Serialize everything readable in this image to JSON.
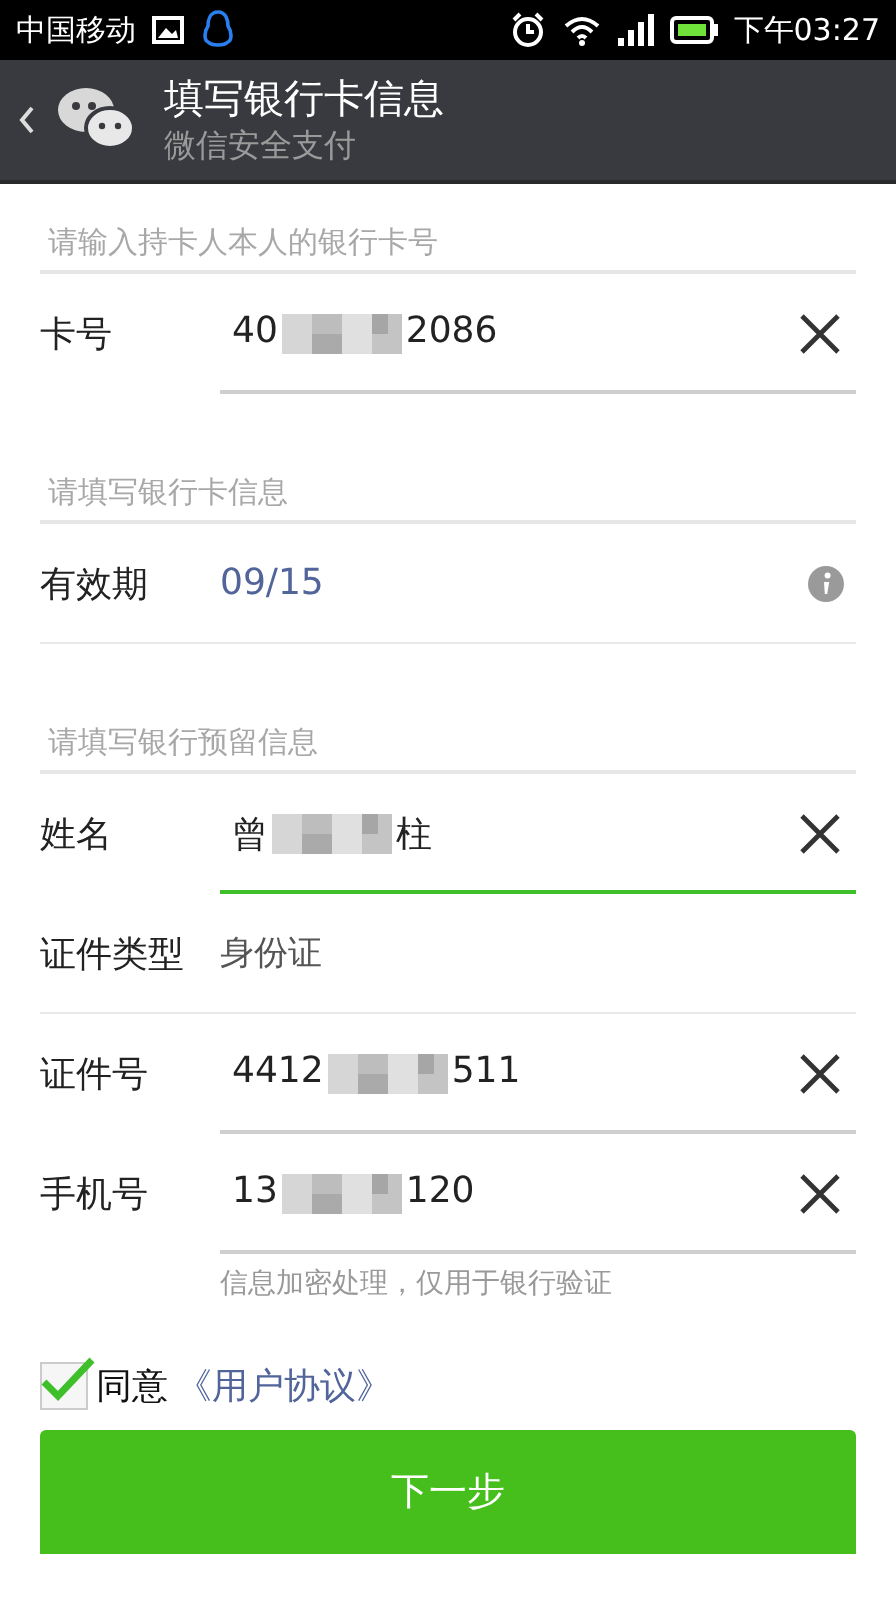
{
  "status_bar": {
    "carrier": "中国移动",
    "time": "下午03:27"
  },
  "header": {
    "title": "填写银行卡信息",
    "subtitle": "微信安全支付"
  },
  "sections": [
    {
      "heading": "请输入持卡人本人的银行卡号",
      "rows": [
        {
          "kind": "input",
          "label": "卡号",
          "value_parts": [
            "40",
            "2086"
          ],
          "focused": false
        }
      ]
    },
    {
      "heading": "请填写银行卡信息",
      "rows": [
        {
          "kind": "info",
          "label": "有效期",
          "value": "09/15"
        }
      ]
    },
    {
      "heading": "请填写银行预留信息",
      "rows": [
        {
          "kind": "input",
          "label": "姓名",
          "value_parts": [
            "曾",
            "柱"
          ],
          "focused": true
        },
        {
          "kind": "static",
          "label": "证件类型",
          "value": "身份证"
        },
        {
          "kind": "input",
          "label": "证件号",
          "value_parts": [
            "4412",
            "511"
          ],
          "focused": false
        },
        {
          "kind": "input",
          "label": "手机号",
          "value_parts": [
            "13",
            "120"
          ],
          "focused": false
        }
      ]
    }
  ],
  "hint": "信息加密处理，仅用于银行验证",
  "agreement": {
    "checked": true,
    "text": "同意",
    "link": "《用户协议》"
  },
  "next_button": "下一步"
}
